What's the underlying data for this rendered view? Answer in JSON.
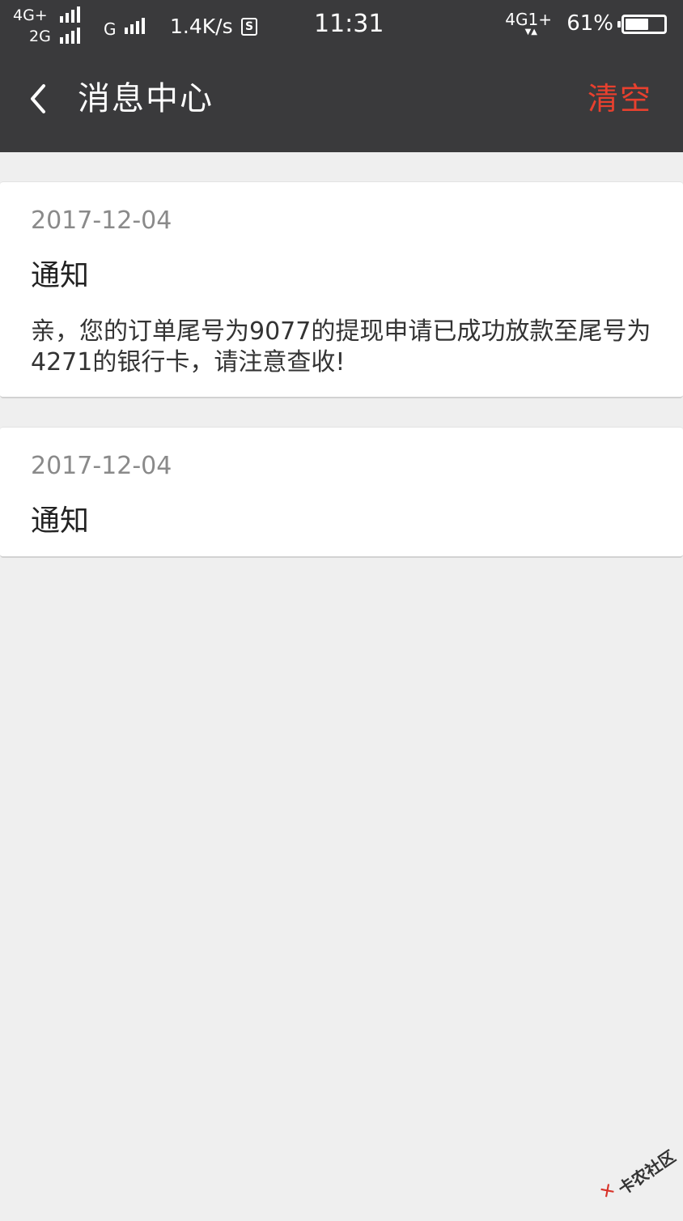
{
  "status_bar": {
    "net1_label": "4G+",
    "net2_label": "2G",
    "net3_label": "G",
    "speed": "1.4K/s",
    "s_icon": "S",
    "time": "11:31",
    "net_right": "4G1+",
    "battery_percent": "61%",
    "battery_level": 0.61
  },
  "header": {
    "back_icon": "chevron-left-icon",
    "title": "消息中心",
    "clear_label": "清空",
    "clear_color": "#e8402e",
    "bar_color": "#3a3a3c"
  },
  "messages": [
    {
      "date": "2017-12-04",
      "title": "通知",
      "body": "亲，您的订单尾号为9077的提现申请已成功放款至尾号为4271的银行卡，请注意查收!"
    },
    {
      "date": "2017-12-04",
      "title": "通知",
      "body": ""
    }
  ],
  "watermark": {
    "logo_icon": "kanong-logo-icon",
    "text": "卡农社区"
  }
}
